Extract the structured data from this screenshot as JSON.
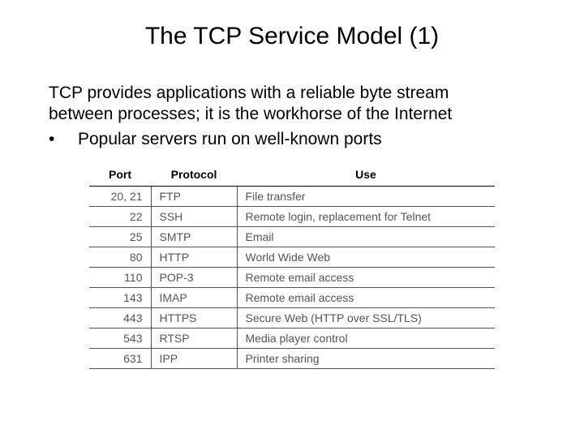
{
  "title": "The TCP Service Model (1)",
  "intro_line1": "TCP provides applications with a reliable byte stream",
  "intro_line2": "between processes; it is the workhorse of the Internet",
  "bullet_mark": "•",
  "bullet_text": "Popular servers run on well-known ports",
  "table": {
    "headers": {
      "port": "Port",
      "protocol": "Protocol",
      "use": "Use"
    },
    "rows": [
      {
        "port": "20, 21",
        "protocol": "FTP",
        "use": "File transfer"
      },
      {
        "port": "22",
        "protocol": "SSH",
        "use": "Remote login, replacement for Telnet"
      },
      {
        "port": "25",
        "protocol": "SMTP",
        "use": "Email"
      },
      {
        "port": "80",
        "protocol": "HTTP",
        "use": "World Wide Web"
      },
      {
        "port": "110",
        "protocol": "POP-3",
        "use": "Remote email access"
      },
      {
        "port": "143",
        "protocol": "IMAP",
        "use": "Remote email access"
      },
      {
        "port": "443",
        "protocol": "HTTPS",
        "use": "Secure Web (HTTP over SSL/TLS)"
      },
      {
        "port": "543",
        "protocol": "RTSP",
        "use": "Media player control"
      },
      {
        "port": "631",
        "protocol": "IPP",
        "use": "Printer sharing"
      }
    ]
  }
}
